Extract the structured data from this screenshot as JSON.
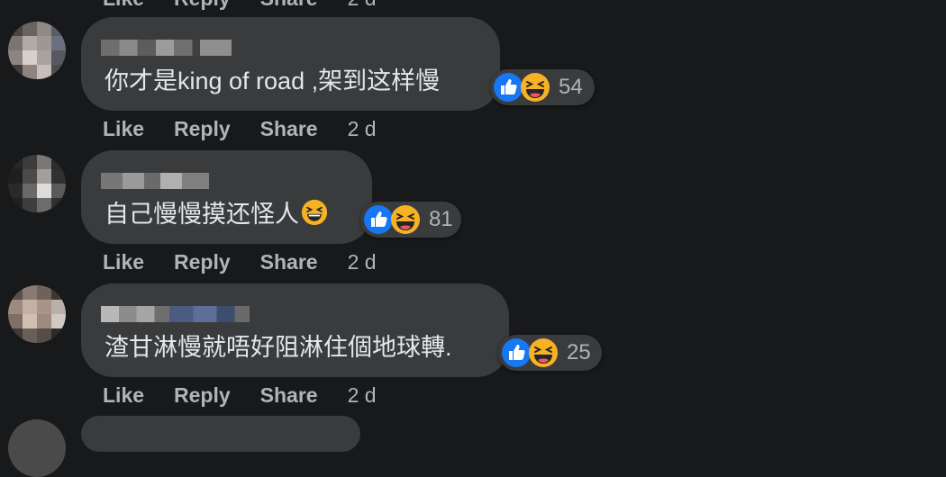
{
  "actions": {
    "like": "Like",
    "reply": "Reply",
    "share": "Share"
  },
  "comments": [
    {
      "text": "你才是king of road ,架到这样慢",
      "reaction_count": "54",
      "time": "2 d"
    },
    {
      "text": "自己慢慢摸还怪人",
      "reaction_count": "81",
      "time": "2 d"
    },
    {
      "text": "渣甘淋慢就唔好阻淋住個地球轉.",
      "reaction_count": "25",
      "time": "2 d"
    }
  ],
  "icons": {
    "like": "like-reaction-icon",
    "haha": "haha-reaction-icon",
    "inline_emoji": "grinning-squint-emoji"
  },
  "colors": {
    "background": "#18191a",
    "bubble": "#3a3b3c",
    "text": "#e4e6eb",
    "secondary_text": "#b0b3b8",
    "like_blue": "#1877f2",
    "haha_yellow": "#f7b125"
  }
}
